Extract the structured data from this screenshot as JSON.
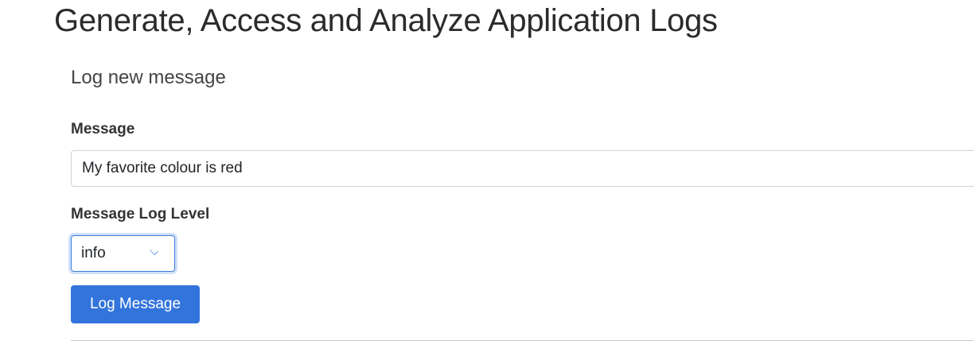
{
  "page": {
    "title": "Generate, Access and Analyze Application Logs",
    "section_title": "Log new message"
  },
  "form": {
    "message_label": "Message",
    "message_value": "My favorite colour is red",
    "level_label": "Message Log Level",
    "level_value": "info",
    "submit_label": "Log Message"
  }
}
